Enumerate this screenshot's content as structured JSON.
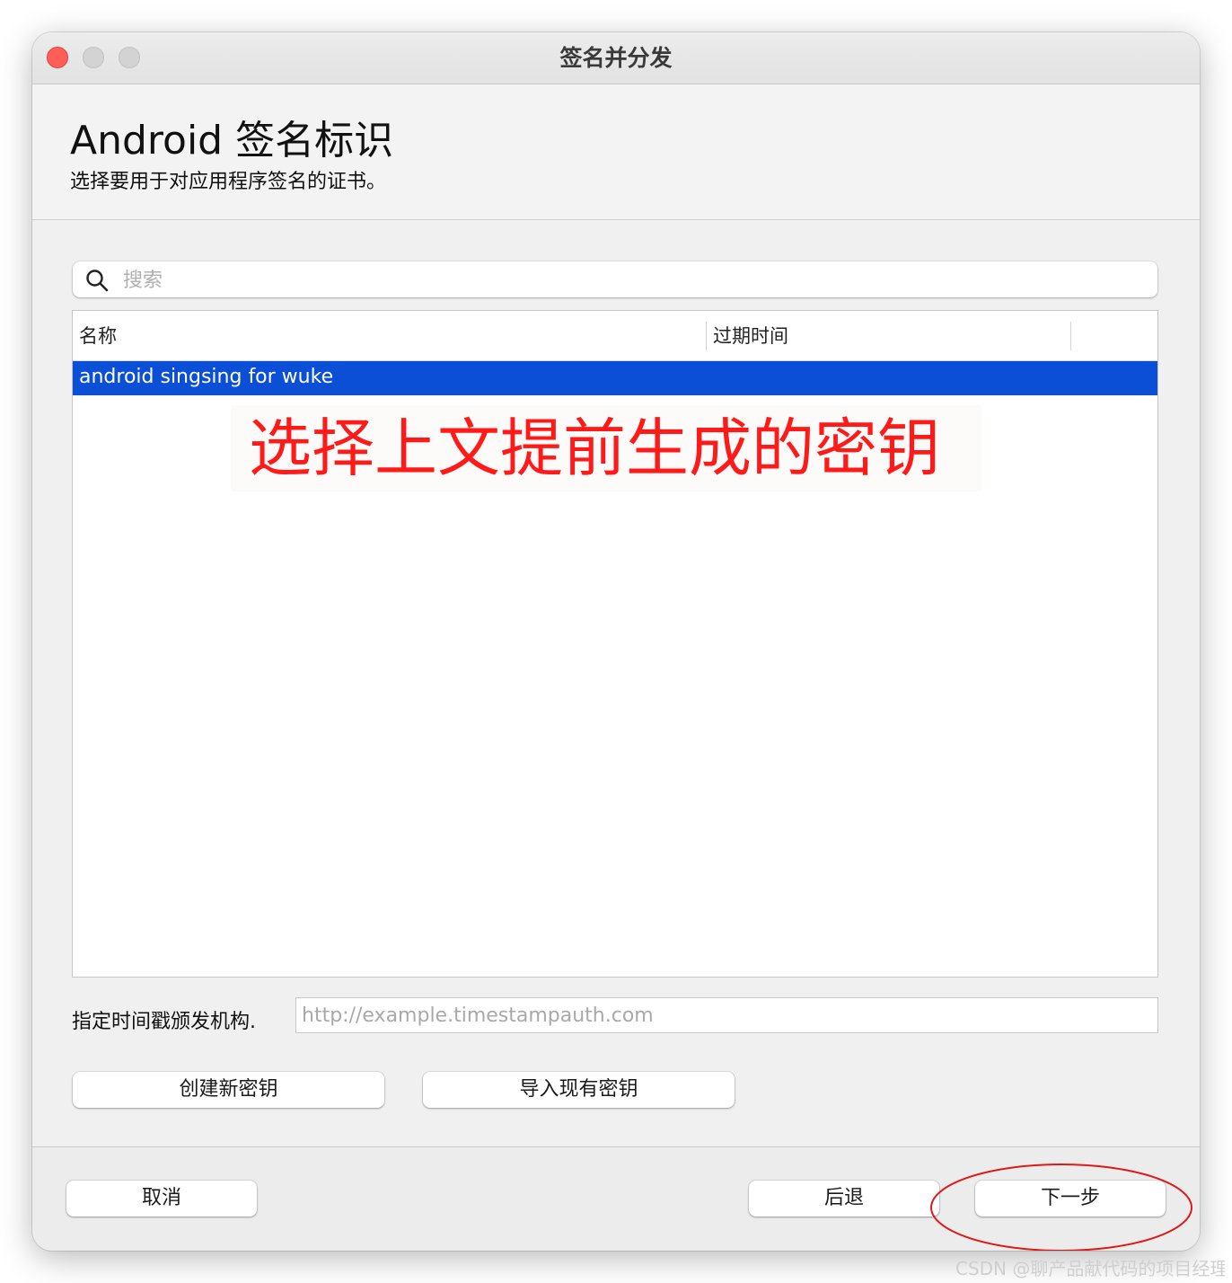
{
  "window": {
    "title": "签名并分发"
  },
  "header": {
    "title": "Android 签名标识",
    "subtitle": "选择要用于对应用程序签名的证书。"
  },
  "search": {
    "placeholder": "搜索",
    "value": ""
  },
  "table": {
    "columns": [
      "名称",
      "过期时间"
    ],
    "rows": [
      {
        "name": "android singsing for wuke",
        "expires": "",
        "selected": true
      }
    ]
  },
  "annotation": {
    "text": "选择上文提前生成的密钥",
    "color": "#ff1a1a"
  },
  "timestamp": {
    "label": "指定时间戳颁发机构.",
    "placeholder": "http://example.timestampauth.com",
    "value": ""
  },
  "actions": {
    "create_key": "创建新密钥",
    "import_key": "导入现有密钥"
  },
  "footer": {
    "cancel": "取消",
    "back": "后退",
    "next": "下一步"
  },
  "watermark": "CSDN @聊产品献代码的项目经理",
  "colors": {
    "selection": "#0a4fd6",
    "close_button": "#fe5f57",
    "annotation_red": "#ff1a1a"
  }
}
